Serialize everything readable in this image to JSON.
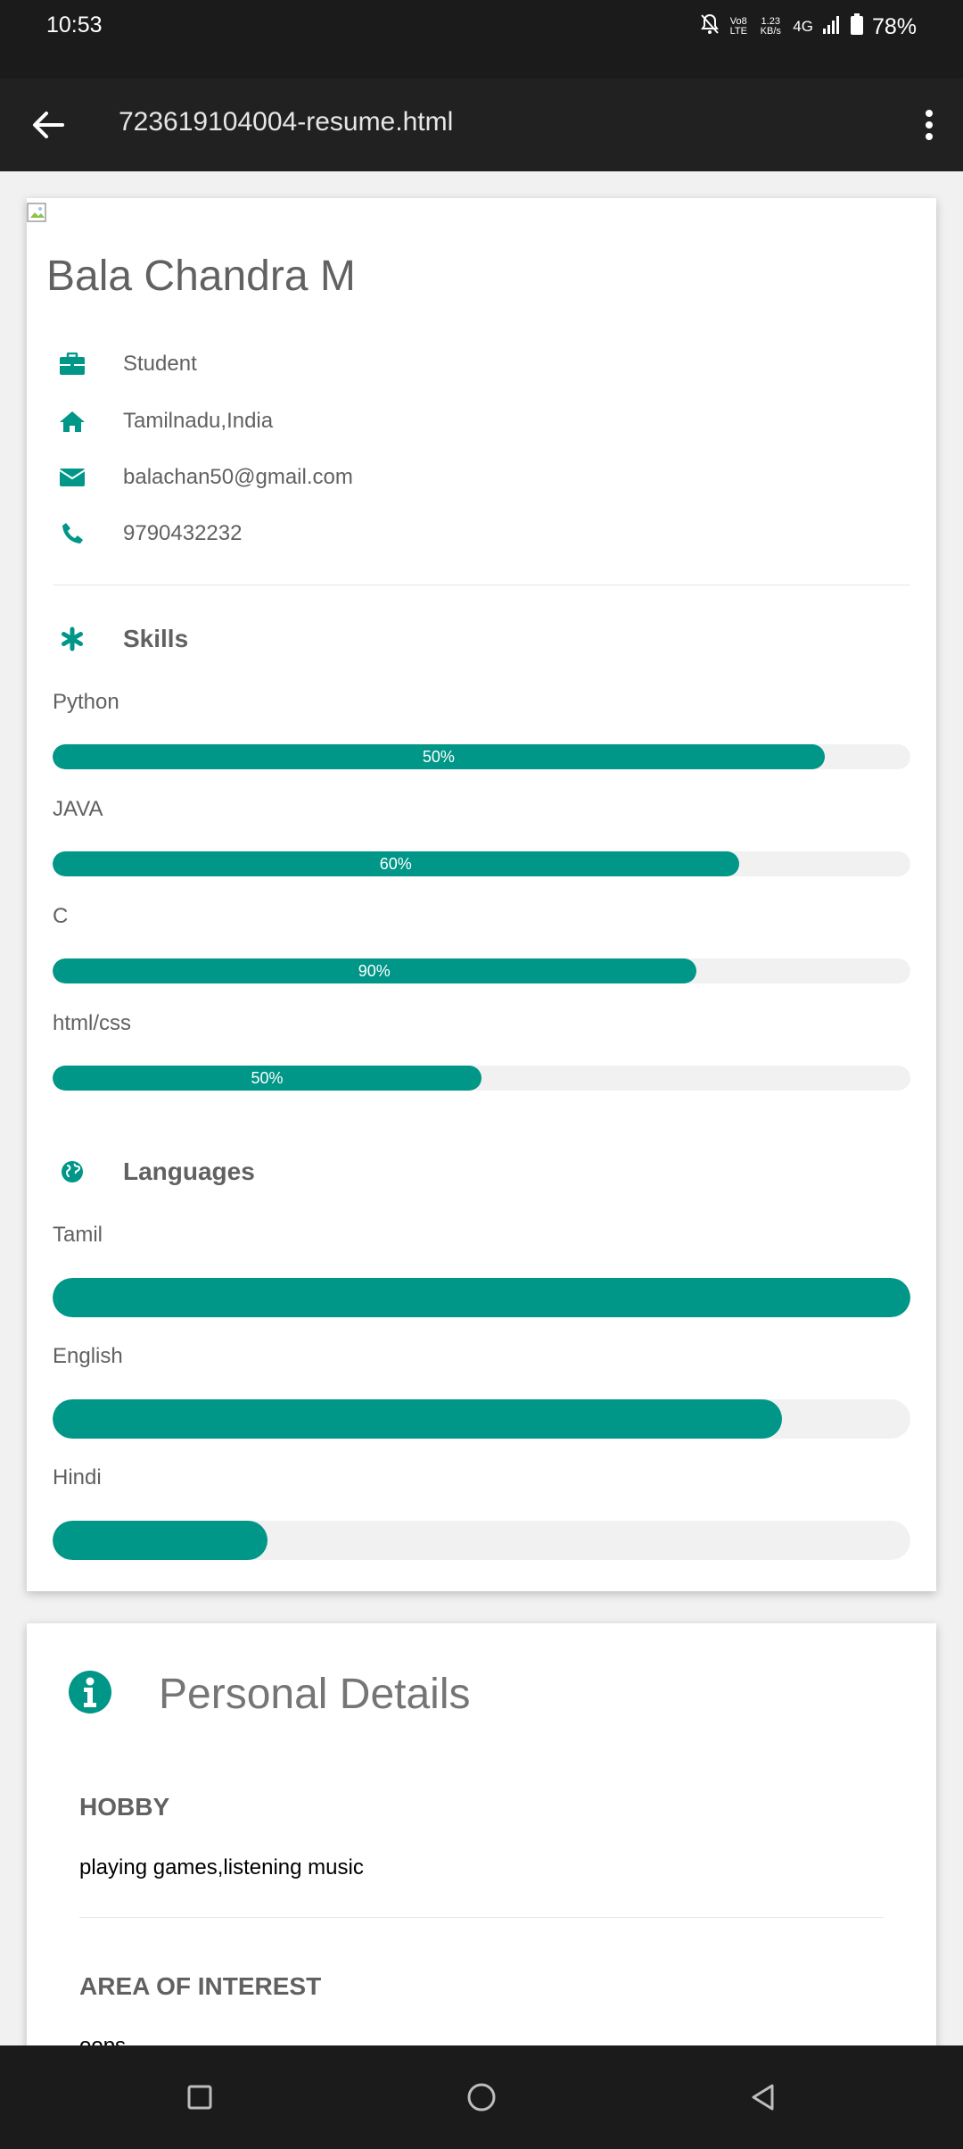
{
  "status_bar": {
    "time": "10:53",
    "volte": "Vo8 LTE",
    "speed": "1.23 KB/s",
    "network": "4G",
    "battery": "78%"
  },
  "app_bar": {
    "title": "723619104004-resume.html"
  },
  "profile": {
    "name": "Bala Chandra M",
    "info": [
      {
        "icon": "briefcase-icon",
        "text": "Student"
      },
      {
        "icon": "home-icon",
        "text": "Tamilnadu,India"
      },
      {
        "icon": "envelope-icon",
        "text": "balachan50@gmail.com"
      },
      {
        "icon": "phone-icon",
        "text": "9790432232"
      }
    ]
  },
  "skills": {
    "title": "Skills",
    "items": [
      {
        "label": "Python",
        "text": "50%",
        "fill": 0.9
      },
      {
        "label": "JAVA",
        "text": "60%",
        "fill": 0.8
      },
      {
        "label": "C",
        "text": "90%",
        "fill": 0.75
      },
      {
        "label": "html/css",
        "text": "50%",
        "fill": 0.5
      }
    ]
  },
  "languages": {
    "title": "Languages",
    "items": [
      {
        "label": "Tamil",
        "fill": 1.0
      },
      {
        "label": "English",
        "fill": 0.85
      },
      {
        "label": "Hindi",
        "fill": 0.25
      }
    ]
  },
  "personal": {
    "title": "Personal Details",
    "hobby_label": "HOBBY",
    "hobby_value": "playing games,listening music",
    "interest_label": "AREA OF INTEREST",
    "interest_value": "oops"
  },
  "colors": {
    "accent": "#009688",
    "track": "#f1f1f1",
    "bar_dark": "#1b1b1b",
    "app_bar": "#212121"
  }
}
